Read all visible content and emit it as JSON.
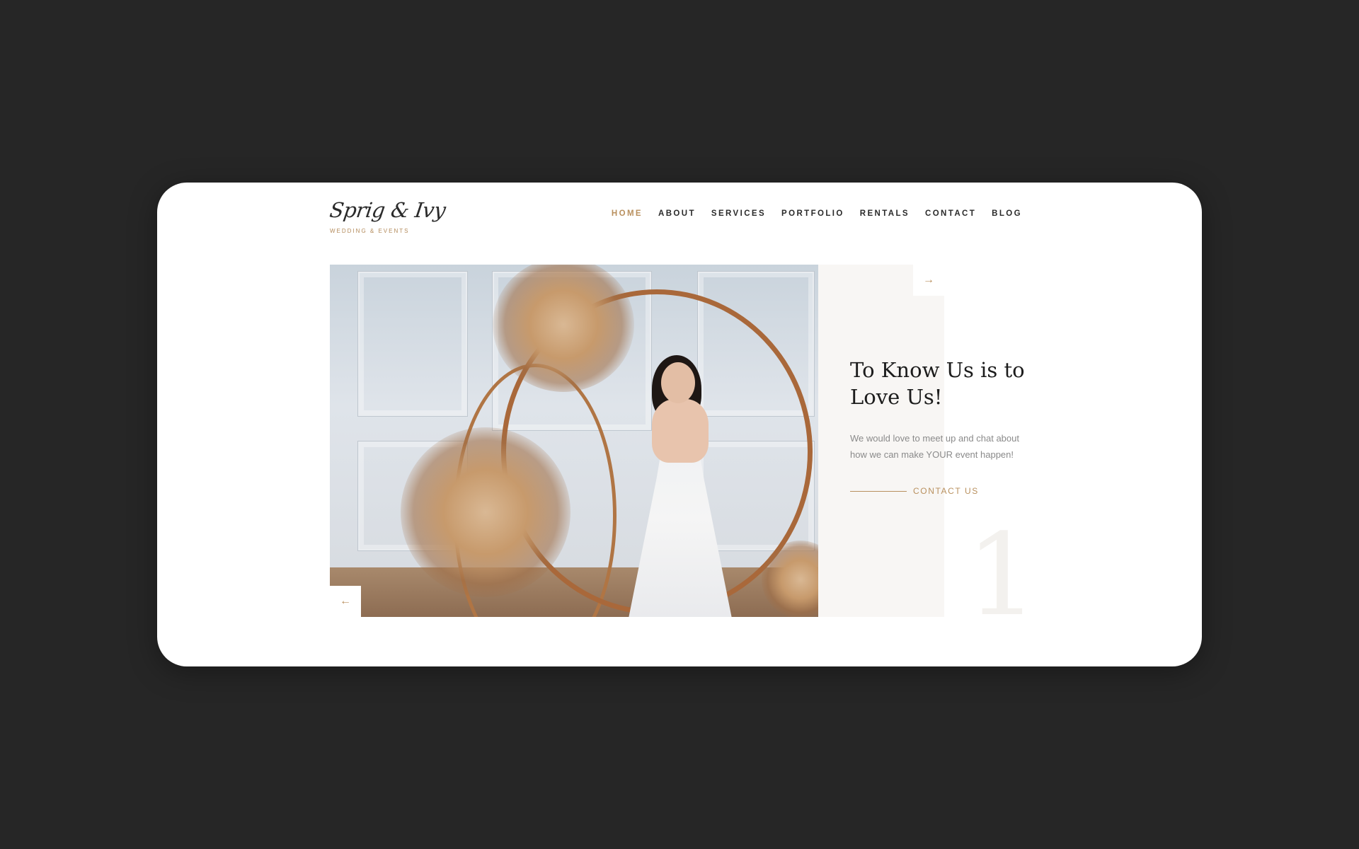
{
  "brand": {
    "name": "Sprig & Ivy",
    "tagline": "WEDDING & EVENTS"
  },
  "nav": {
    "items": [
      {
        "label": "HOME",
        "active": true
      },
      {
        "label": "ABOUT",
        "active": false
      },
      {
        "label": "SERVICES",
        "active": false
      },
      {
        "label": "PORTFOLIO",
        "active": false
      },
      {
        "label": "RENTALS",
        "active": false
      },
      {
        "label": "CONTACT",
        "active": false
      },
      {
        "label": "BLOG",
        "active": false
      }
    ]
  },
  "slider": {
    "prev_icon": "arrow-left-icon",
    "next_icon": "arrow-right-icon",
    "prev_glyph": "←",
    "next_glyph": "→",
    "image_description_icon": "bride-with-floral-arch-photo",
    "slide_number": "1"
  },
  "hero": {
    "headline": "To Know Us is to Love Us!",
    "body": "We would love to meet up and chat about how we can make YOUR event happen!",
    "cta_label": "CONTACT US"
  },
  "colors": {
    "background": "#262626",
    "card": "#ffffff",
    "accent": "#b9905e",
    "text_dark": "#1c1c1c",
    "text_muted": "#8a8a8a",
    "panel": "#f8f6f4"
  }
}
